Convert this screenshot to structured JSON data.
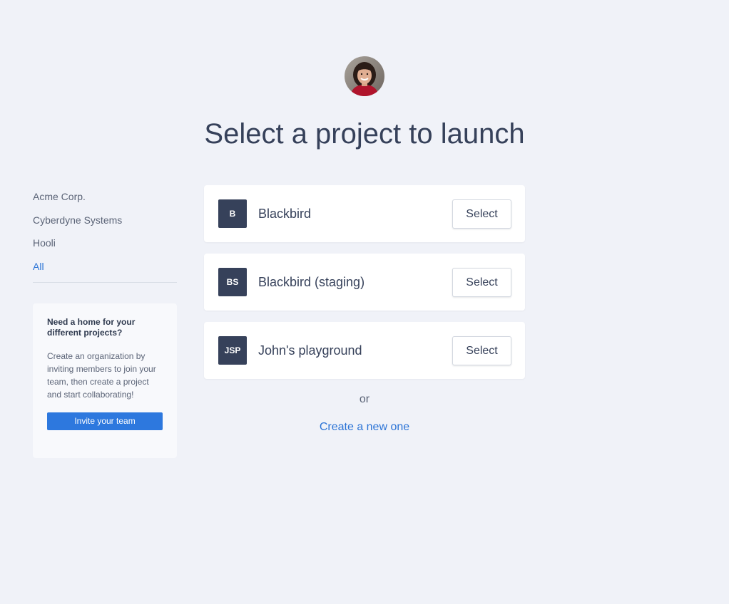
{
  "header": {
    "avatar_icon": "user-avatar-photo",
    "title": "Select a project to launch"
  },
  "organizations": {
    "items": [
      {
        "label": "Acme Corp.",
        "active": false
      },
      {
        "label": "Cyberdyne Systems",
        "active": false
      },
      {
        "label": "Hooli",
        "active": false
      },
      {
        "label": "All",
        "active": true
      }
    ]
  },
  "promo": {
    "title": "Need a home for your different projects?",
    "text": "Create an organization by inviting members to join your team, then create a project and start collaborating!",
    "button_label": "Invite your team"
  },
  "projects": [
    {
      "initials": "B",
      "name": "Blackbird",
      "button_label": "Select"
    },
    {
      "initials": "BS",
      "name": "Blackbird (staging)",
      "button_label": "Select"
    },
    {
      "initials": "JSP",
      "name": "John's playground",
      "button_label": "Select"
    }
  ],
  "footer": {
    "or_text": "or",
    "create_link": "Create a new one"
  },
  "colors": {
    "background": "#f0f2f8",
    "text": "#36415a",
    "accent": "#2c74d6",
    "button_primary": "#2d78de",
    "badge": "#36415a"
  }
}
